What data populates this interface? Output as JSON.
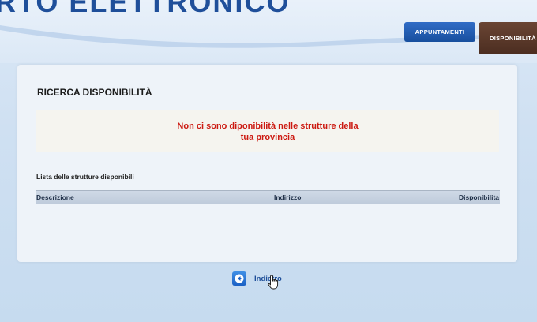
{
  "header": {
    "brand_text": "RTO ELETTRONICO",
    "tabs": [
      "APPUNTAMENTI",
      "DISPONIBILITÀ"
    ]
  },
  "panel": {
    "title": "RICERCA DISPONIBILITÀ",
    "alert_line1": "Non ci sono diponibilità nelle strutture della",
    "alert_line2": "tua provincia",
    "list_label": "Lista delle strutture disponibili",
    "columns": [
      "Descrizione",
      "Indirizzo",
      "Disponibilita"
    ]
  },
  "footer": {
    "back_label": "Indietro"
  },
  "icons": {
    "back": "arrow-left-icon",
    "cursor": "hand-pointer-icon"
  },
  "colors": {
    "brand": "#1f4f9a",
    "alert": "#cc1a12",
    "tab_active": "#4b2d20",
    "tab": "#184f9e"
  }
}
